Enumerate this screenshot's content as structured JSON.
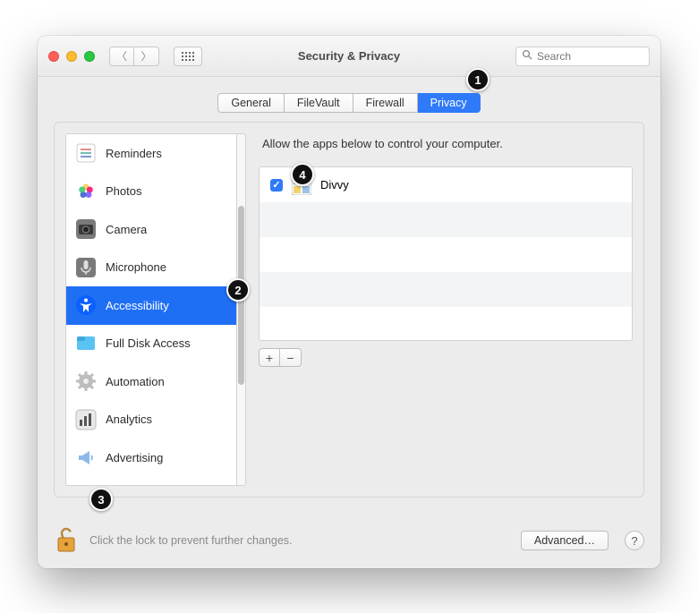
{
  "window": {
    "title": "Security & Privacy"
  },
  "search": {
    "placeholder": "Search"
  },
  "tabs": [
    {
      "label": "General",
      "active": false
    },
    {
      "label": "FileVault",
      "active": false
    },
    {
      "label": "Firewall",
      "active": false
    },
    {
      "label": "Privacy",
      "active": true
    }
  ],
  "sidebar": {
    "items": [
      {
        "label": "Reminders",
        "icon": "reminders-icon",
        "active": false
      },
      {
        "label": "Photos",
        "icon": "photos-icon",
        "active": false
      },
      {
        "label": "Camera",
        "icon": "camera-icon",
        "active": false
      },
      {
        "label": "Microphone",
        "icon": "microphone-icon",
        "active": false
      },
      {
        "label": "Accessibility",
        "icon": "accessibility-icon",
        "active": true
      },
      {
        "label": "Full Disk Access",
        "icon": "full-disk-access-icon",
        "active": false
      },
      {
        "label": "Automation",
        "icon": "automation-icon",
        "active": false
      },
      {
        "label": "Analytics",
        "icon": "analytics-icon",
        "active": false
      },
      {
        "label": "Advertising",
        "icon": "advertising-icon",
        "active": false
      }
    ]
  },
  "main": {
    "instruction": "Allow the apps below to control your computer.",
    "apps": [
      {
        "name": "Divvy",
        "checked": true
      }
    ],
    "add_label": "+",
    "remove_label": "−"
  },
  "footer": {
    "lock_text": "Click the lock to prevent further changes.",
    "advanced_label": "Advanced…",
    "help_label": "?"
  },
  "callouts": [
    "1",
    "2",
    "3",
    "4"
  ]
}
